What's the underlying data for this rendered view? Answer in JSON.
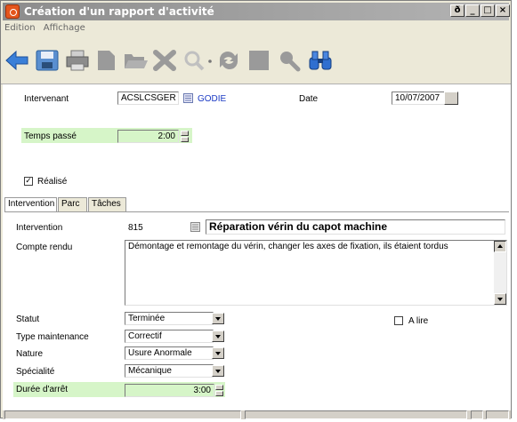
{
  "window": {
    "title": "Création d'un rapport d'activité",
    "controls": [
      "restore-icon",
      "minimize-icon",
      "maximize-icon",
      "close-icon"
    ]
  },
  "menu": {
    "items": [
      "Edition",
      "Affichage"
    ]
  },
  "toolbar": {
    "tools": [
      {
        "name": "back-arrow-icon",
        "color": "#3a7fd8"
      },
      {
        "name": "save-disk-icon",
        "color": "#5a8fd0"
      },
      {
        "name": "print-icon",
        "color": "#8c8c8c"
      },
      {
        "name": "document-icon",
        "color": "#9a9a9a"
      },
      {
        "name": "folder-open-icon",
        "color": "#9a9a9a"
      },
      {
        "name": "delete-x-icon",
        "color": "#9a9a9a"
      },
      {
        "name": "zoom-icon",
        "color": "#bdbdbd"
      },
      {
        "name": "refresh-icon",
        "color": "#9a9a9a"
      },
      {
        "name": "square-icon",
        "color": "#9a9a9a"
      },
      {
        "name": "magnifier-icon",
        "color": "#9a9a9a"
      },
      {
        "name": "binoculars-icon",
        "color": "#2f6fd0"
      }
    ]
  },
  "form": {
    "intervenant_label": "Intervenant",
    "intervenant_value": "ACSLCSGER",
    "intervenant_name": "GODIE",
    "date_label": "Date",
    "date_value": "10/07/2007",
    "temps_label": "Temps passé",
    "temps_value": "2:00",
    "realise_label": "Réalisé",
    "realise_checked": true
  },
  "tabs": [
    "Intervention",
    "Parc",
    "Tâches"
  ],
  "intervention": {
    "intervention_label": "Intervention",
    "intervention_number": "815",
    "intervention_title": "Réparation vérin du capot machine",
    "compte_rendu_label": "Compte rendu",
    "compte_rendu_text": "Démontage et remontage du vérin, changer les axes de fixation, ils étaient tordus",
    "statut_label": "Statut",
    "statut_value": "Terminée",
    "type_label": "Type maintenance",
    "type_value": "Correctif",
    "nature_label": "Nature",
    "nature_value": "Usure Anormale",
    "specialite_label": "Spécialité",
    "specialite_value": "Mécanique",
    "duree_label": "Durée d'arrêt",
    "duree_value": "3:00",
    "alire_label": "A lire",
    "alire_checked": false
  },
  "colors": {
    "accent_green": "#d6f5c8",
    "link_blue": "#1a39c4"
  }
}
